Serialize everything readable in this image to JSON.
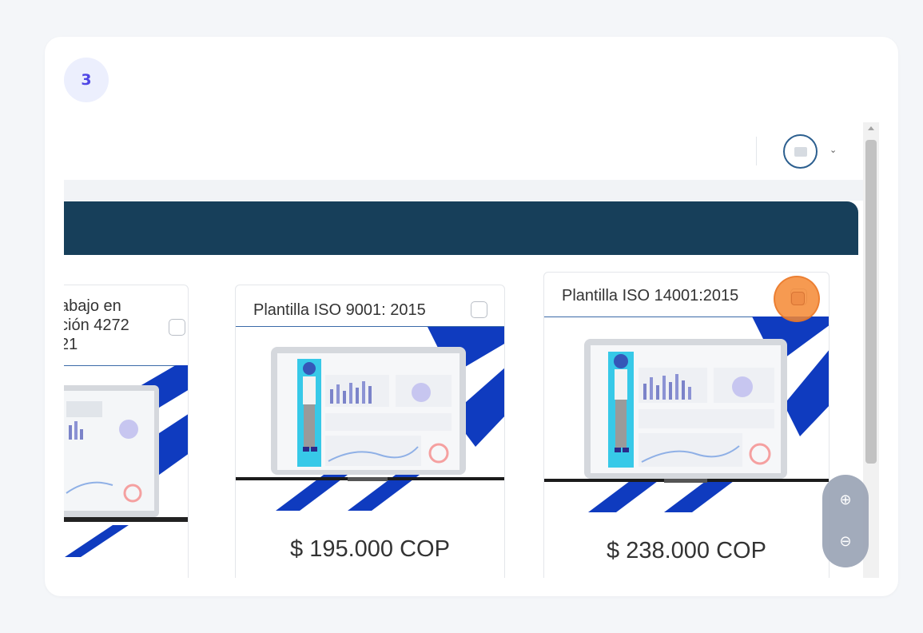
{
  "step": {
    "number": "3"
  },
  "colors": {
    "banner": "#173f5a",
    "stripe": "#0f3bbf",
    "accent_cursor": "#f48832",
    "badge_text": "#4f46e5"
  },
  "header": {
    "avatar_icon": "user-avatar-icon",
    "chevron_icon": "chevron-down-icon",
    "chevron_glyph": "⌄"
  },
  "products": [
    {
      "title_lines": [
        "abajo en",
        "ción 4272",
        "21"
      ],
      "price": ""
    },
    {
      "title_lines": [
        "Plantilla ISO 9001: 2015"
      ],
      "price": "$ 195.000 COP"
    },
    {
      "title_lines": [
        "Plantilla ISO 14001:2015"
      ],
      "price": "$ 238.000 COP"
    }
  ],
  "zoom": {
    "in_icon": "zoom-in-icon",
    "out_icon": "zoom-out-icon",
    "in_glyph": "⊕",
    "out_glyph": "⊖"
  }
}
